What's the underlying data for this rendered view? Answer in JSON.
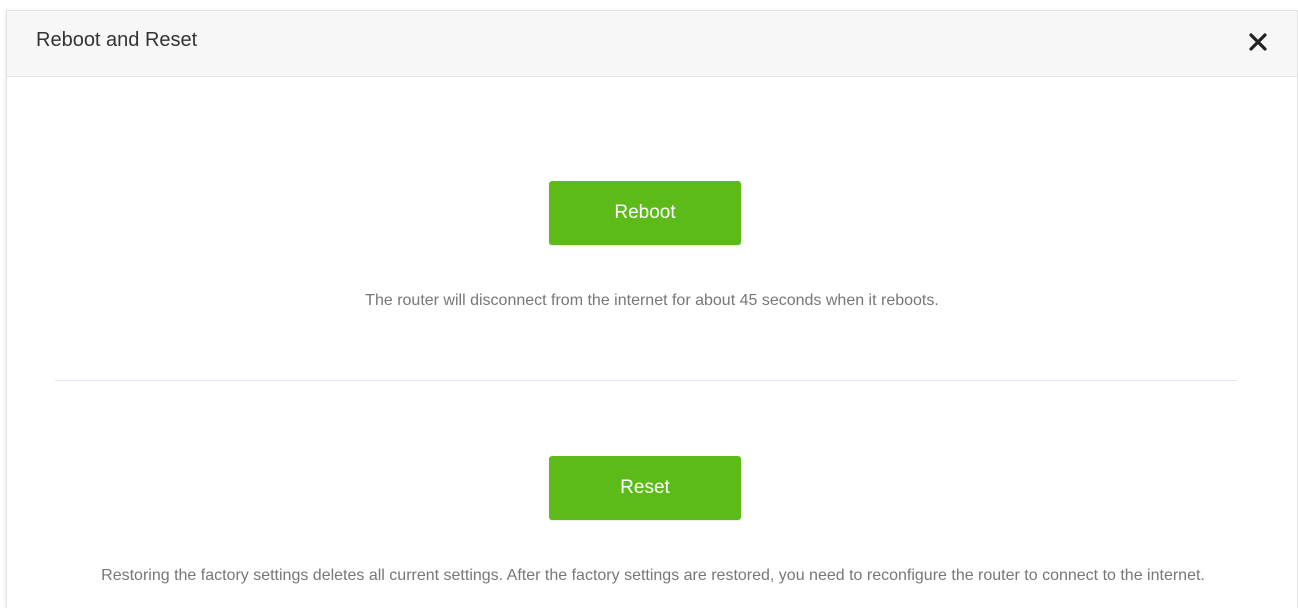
{
  "dialog": {
    "title": "Reboot and Reset",
    "close_icon": "close-icon"
  },
  "reboot": {
    "button_label": "Reboot",
    "description": "The router will disconnect from the internet for about 45 seconds when it reboots."
  },
  "reset": {
    "button_label": "Reset",
    "description": "Restoring the factory settings deletes all current settings. After the factory settings are restored, you need to reconfigure the router to connect to the internet."
  },
  "colors": {
    "button_bg": "#5dbb19",
    "button_text": "#ffffff",
    "title_text": "#333333",
    "description_text": "#777777",
    "header_bg": "#f7f7f7",
    "divider": "#dde6ee"
  }
}
